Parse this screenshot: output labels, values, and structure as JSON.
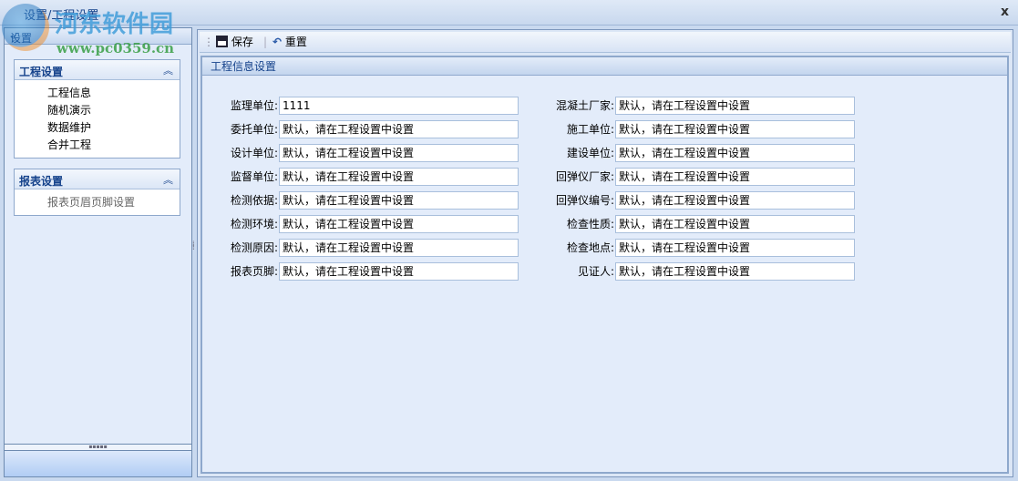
{
  "window": {
    "title": "设置/工程设置",
    "close": "x"
  },
  "watermark": {
    "name": "河东软件园",
    "url": "www.pc0359.cn"
  },
  "left": {
    "header": "设置",
    "collapse": "«",
    "groups": [
      {
        "title": "工程设置",
        "chevron": "︽",
        "items": [
          "工程信息",
          "随机演示",
          "数据维护",
          "合并工程"
        ]
      },
      {
        "title": "报表设置",
        "chevron": "︽",
        "items": [
          "报表页眉页脚设置"
        ]
      }
    ]
  },
  "toolbar": {
    "save": "保存",
    "reset": "重置"
  },
  "section": {
    "title": "工程信息设置"
  },
  "fields_left": [
    {
      "label": "监理单位:",
      "value": "1111"
    },
    {
      "label": "委托单位:",
      "value": "默认，请在工程设置中设置"
    },
    {
      "label": "设计单位:",
      "value": "默认，请在工程设置中设置"
    },
    {
      "label": "监督单位:",
      "value": "默认，请在工程设置中设置"
    },
    {
      "label": "检测依据:",
      "value": "默认，请在工程设置中设置"
    },
    {
      "label": "检测环境:",
      "value": "默认，请在工程设置中设置"
    },
    {
      "label": "检测原因:",
      "value": "默认，请在工程设置中设置"
    },
    {
      "label": "报表页脚:",
      "value": "默认，请在工程设置中设置"
    }
  ],
  "fields_right": [
    {
      "label": "混凝土厂家:",
      "value": "默认，请在工程设置中设置"
    },
    {
      "label": "施工单位:",
      "value": "默认，请在工程设置中设置"
    },
    {
      "label": "建设单位:",
      "value": "默认，请在工程设置中设置"
    },
    {
      "label": "回弹仪厂家:",
      "value": "默认，请在工程设置中设置"
    },
    {
      "label": "回弹仪编号:",
      "value": "默认，请在工程设置中设置"
    },
    {
      "label": "检查性质:",
      "value": "默认，请在工程设置中设置"
    },
    {
      "label": "检查地点:",
      "value": "默认，请在工程设置中设置"
    },
    {
      "label": "见证人:",
      "value": "默认，请在工程设置中设置"
    }
  ]
}
